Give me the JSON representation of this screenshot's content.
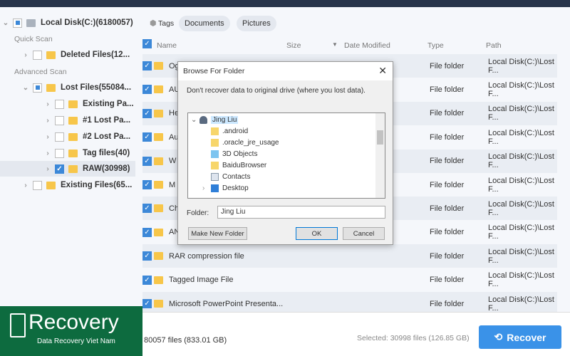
{
  "sidebar": {
    "root": "Local Disk(C:)(6180057)",
    "quick_scan": "Quick Scan",
    "deleted": "Deleted Files(12...",
    "advanced_scan": "Advanced Scan",
    "lost": "Lost Files(55084...",
    "children": [
      "Existing Pa...",
      "#1 Lost Pa...",
      "#2 Lost Pa...",
      "Tag files(40)",
      "RAW(30998)"
    ],
    "existing": "Existing Files(65..."
  },
  "tags": {
    "label": "Tags",
    "items": [
      "Documents",
      "Pictures"
    ]
  },
  "columns": {
    "name": "Name",
    "size": "Size",
    "date": "Date Modified",
    "type": "Type",
    "path": "Path"
  },
  "rows": [
    {
      "name": "Og",
      "type": "File folder",
      "path": "Local Disk(C:)\\Lost F..."
    },
    {
      "name": "AU",
      "type": "File folder",
      "path": "Local Disk(C:)\\Lost F..."
    },
    {
      "name": "He",
      "type": "File folder",
      "path": "Local Disk(C:)\\Lost F..."
    },
    {
      "name": "Au",
      "type": "File folder",
      "path": "Local Disk(C:)\\Lost F..."
    },
    {
      "name": "W",
      "type": "File folder",
      "path": "Local Disk(C:)\\Lost F..."
    },
    {
      "name": "M",
      "type": "File folder",
      "path": "Local Disk(C:)\\Lost F..."
    },
    {
      "name": "Ch",
      "type": "File folder",
      "path": "Local Disk(C:)\\Lost F..."
    },
    {
      "name": "AN",
      "type": "File folder",
      "path": "Local Disk(C:)\\Lost F..."
    },
    {
      "name": "RAR compression file",
      "type": "File folder",
      "path": "Local Disk(C:)\\Lost F..."
    },
    {
      "name": "Tagged Image File",
      "type": "File folder",
      "path": "Local Disk(C:)\\Lost F..."
    },
    {
      "name": "Microsoft PowerPoint Presenta...",
      "type": "File folder",
      "path": "Local Disk(C:)\\Lost F..."
    }
  ],
  "footer": {
    "total": "80057 files (833.01 GB)",
    "selected": "Selected: 30998 files (126.85 GB)",
    "recover": "Recover"
  },
  "logo": {
    "name": "Recovery",
    "tagline": "Data Recovery Viet Nam"
  },
  "dialog": {
    "title": "Browse For Folder",
    "message": "Don't recover data to original drive (where you lost data).",
    "tree": [
      "Jing Liu",
      ".android",
      ".oracle_jre_usage",
      "3D Objects",
      "BaiduBrowser",
      "Contacts",
      "Desktop"
    ],
    "folder_label": "Folder:",
    "folder_value": "Jing Liu",
    "make_new": "Make New Folder",
    "ok": "OK",
    "cancel": "Cancel"
  },
  "colors": {
    "accent": "#3a92e8",
    "logo_bg": "#0d6b3f",
    "topbar": "#27344a"
  }
}
